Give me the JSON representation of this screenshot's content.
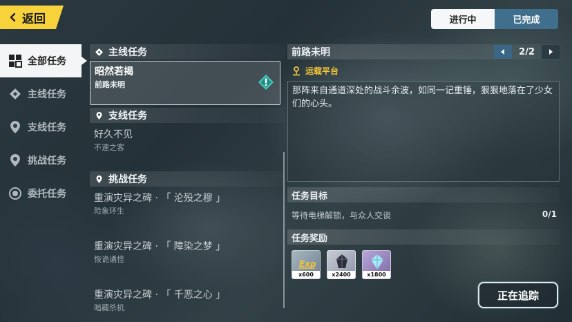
{
  "back": {
    "label": "返回",
    "icon": "chevron-left-icon"
  },
  "nav": {
    "items": [
      {
        "label": "全部任务",
        "icon": "grid-icon",
        "active": true
      },
      {
        "label": "主线任务",
        "icon": "diamond-icon",
        "active": false
      },
      {
        "label": "支线任务",
        "icon": "map-pin-icon",
        "active": false
      },
      {
        "label": "挑战任务",
        "icon": "map-pin-icon",
        "active": false
      },
      {
        "label": "委托任务",
        "icon": "target-icon",
        "active": false
      }
    ]
  },
  "tabs": {
    "in_progress": "进行中",
    "completed": "已完成",
    "active": "completed"
  },
  "quest_list": {
    "main": {
      "title": "主线任务",
      "quests": [
        {
          "title": "昭然若揭",
          "sub": "前路未明",
          "selected": true
        }
      ]
    },
    "side": {
      "title": "支线任务",
      "quests": [
        {
          "title": "好久不见",
          "sub": "不速之客"
        }
      ]
    },
    "challenge": {
      "title": "挑战任务",
      "quests": [
        {
          "title": "重演灾异之碑 · 「 沦殁之穆 」",
          "sub": "险象环生"
        },
        {
          "title": "重演灾异之碑 · 「 障染之梦 」",
          "sub": "恢诡谲怪"
        },
        {
          "title": "重演灾异之碑 · 「 千恶之心 」",
          "sub": "暗藏杀机"
        }
      ]
    }
  },
  "detail": {
    "title": "前路未明",
    "page": "2/2",
    "location": "运载平台",
    "description": "那阵来自通道深处的战斗余波，如同一记重锤，狠狠地落在了少女们的心头。",
    "objective_header": "任务目标",
    "objective_text": "等待电梯解锁，与众人交谈",
    "objective_count": "0/1",
    "reward_header": "任务奖励",
    "rewards": [
      {
        "name": "exp",
        "qty": "x600"
      },
      {
        "name": "dark-item",
        "qty": "x2400"
      },
      {
        "name": "crystal",
        "qty": "x1800"
      }
    ],
    "track_label": "正在追踪"
  },
  "colors": {
    "accent_yellow": "#f7d23a",
    "tab_active": "#3f6f8c",
    "location": "#f3c53a"
  }
}
